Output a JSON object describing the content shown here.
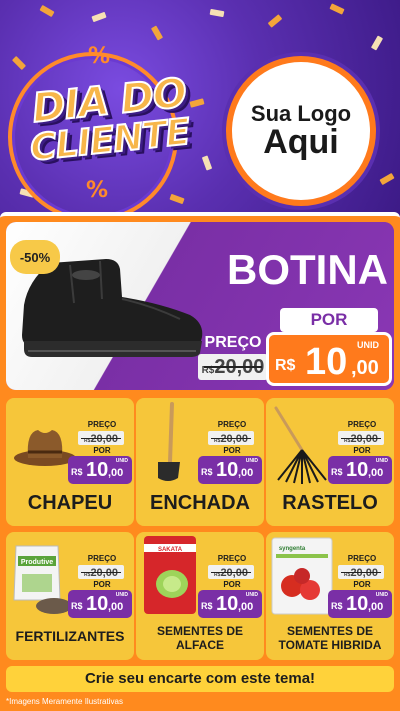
{
  "header": {
    "title_line1": "DIA DO",
    "title_line2": "CLIENTE",
    "percent_symbol": "%",
    "logo_line1": "Sua Logo",
    "logo_line2": "Aqui",
    "colors": {
      "purple": "#5a2fb0",
      "orange": "#ff7a1c",
      "gold": "#f7b64a"
    }
  },
  "hero": {
    "discount": "-50%",
    "name": "BOTINA",
    "preco_label": "PREÇO",
    "old_currency": "R$",
    "old_price": "20,00",
    "por_label": "POR",
    "new_currency": "R$",
    "new_int": "10",
    "new_dec": ",00",
    "unid": "UNID",
    "icon": "work-boot-icon"
  },
  "products": [
    {
      "name": "CHAPEU",
      "icon": "cowboy-hat-icon",
      "preco_label": "PREÇO",
      "old_currency": "R$",
      "old_price": "20,00",
      "por_label": "POR",
      "new_currency": "R$",
      "new_int": "10",
      "new_dec": ",00",
      "unid": "UNID"
    },
    {
      "name": "ENCHADA",
      "icon": "hoe-icon",
      "preco_label": "PREÇO",
      "old_currency": "R$",
      "old_price": "20,00",
      "por_label": "POR",
      "new_currency": "R$",
      "new_int": "10",
      "new_dec": ",00",
      "unid": "UNID"
    },
    {
      "name": "RASTELO",
      "icon": "rake-icon",
      "preco_label": "PREÇO",
      "old_currency": "R$",
      "old_price": "20,00",
      "por_label": "POR",
      "new_currency": "R$",
      "new_int": "10",
      "new_dec": ",00",
      "unid": "UNID"
    },
    {
      "name": "FERTILIZANTES",
      "icon": "fertilizer-bag-icon",
      "pack_text": "Produtive",
      "preco_label": "PREÇO",
      "old_currency": "R$",
      "old_price": "20,00",
      "por_label": "POR",
      "new_currency": "R$",
      "new_int": "10",
      "new_dec": ",00",
      "unid": "UNID"
    },
    {
      "name": "SEMENTES DE ALFACE",
      "icon": "seed-packet-icon",
      "pack_text": "SAKATA",
      "preco_label": "PREÇO",
      "old_currency": "R$",
      "old_price": "20,00",
      "por_label": "POR",
      "new_currency": "R$",
      "new_int": "10",
      "new_dec": ",00",
      "unid": "UNID"
    },
    {
      "name": "SEMENTES DE TOMATE HIBRIDA",
      "icon": "seed-packet-icon",
      "pack_text": "syngenta",
      "preco_label": "PREÇO",
      "old_currency": "R$",
      "old_price": "20,00",
      "por_label": "POR",
      "new_currency": "R$",
      "new_int": "10",
      "new_dec": ",00",
      "unid": "UNID"
    }
  ],
  "footer": {
    "cta": "Crie seu encarte com este tema!",
    "disclaimer": "*Imagens Meramente Ilustrativas"
  }
}
